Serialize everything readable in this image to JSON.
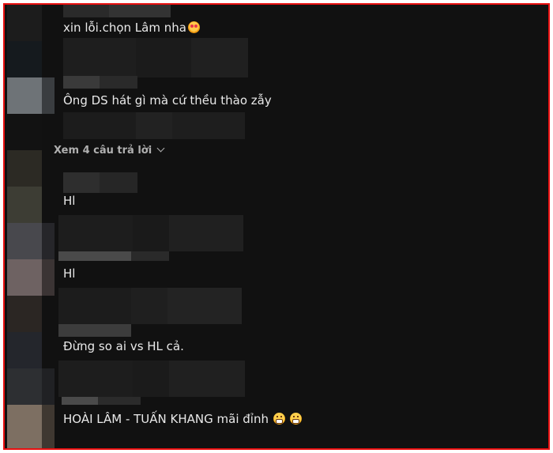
{
  "comments": [
    {
      "text": "xin lỗi.chọn Lâm nha",
      "emoji": [
        "smiling-face-with-hearts"
      ]
    },
    {
      "text": "Ông DS hát gì mà cứ thều thào zẫy",
      "emoji": []
    },
    {
      "text": "Hl",
      "emoji": []
    },
    {
      "text": "Hl",
      "emoji": []
    },
    {
      "text": "Đừng so ai vs HL cả.",
      "emoji": []
    },
    {
      "text": "HOÀI LÂM - TUẤN KHANG mãi đỉnh",
      "emoji": [
        "grinning-face",
        "grinning-face"
      ]
    }
  ],
  "replies_link": {
    "label": "Xem 4 câu trả lời"
  },
  "colors": {
    "background": "#111111",
    "frame_border": "#e81010",
    "text": "#e9e9e9",
    "muted_text": "#b0b0b0"
  }
}
